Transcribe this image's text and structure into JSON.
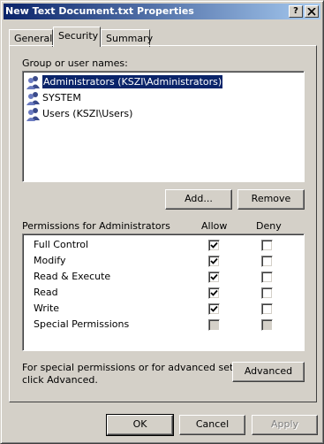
{
  "window": {
    "title": "New Text Document.txt Properties"
  },
  "titlebar": {
    "help_label": "?",
    "close_label": "X"
  },
  "tabs": [
    {
      "label": "General",
      "active": false
    },
    {
      "label": "Security",
      "active": true
    },
    {
      "label": "Summary",
      "active": false
    }
  ],
  "security": {
    "group_label": "Group or user names:",
    "users": [
      {
        "name": "Administrators (KSZI\\Administrators)",
        "selected": true,
        "icon": "user-group-icon"
      },
      {
        "name": "SYSTEM",
        "selected": false,
        "icon": "user-group-icon"
      },
      {
        "name": "Users (KSZI\\Users)",
        "selected": false,
        "icon": "user-group-icon"
      }
    ],
    "add_label": "Add...",
    "remove_label": "Remove",
    "permissions_label": "Permissions for Administrators",
    "allow_header": "Allow",
    "deny_header": "Deny",
    "permissions": [
      {
        "name": "Full Control",
        "allow": true,
        "deny": false,
        "allow_disabled": false,
        "deny_disabled": false
      },
      {
        "name": "Modify",
        "allow": true,
        "deny": false,
        "allow_disabled": false,
        "deny_disabled": false
      },
      {
        "name": "Read & Execute",
        "allow": true,
        "deny": false,
        "allow_disabled": false,
        "deny_disabled": false
      },
      {
        "name": "Read",
        "allow": true,
        "deny": false,
        "allow_disabled": false,
        "deny_disabled": false
      },
      {
        "name": "Write",
        "allow": true,
        "deny": false,
        "allow_disabled": false,
        "deny_disabled": false
      },
      {
        "name": "Special Permissions",
        "allow": false,
        "deny": false,
        "allow_disabled": true,
        "deny_disabled": true
      }
    ],
    "advanced_hint_line1": "For special permissions or for advanced settings,",
    "advanced_hint_line2": "click Advanced.",
    "advanced_label": "Advanced"
  },
  "footer": {
    "ok_label": "OK",
    "cancel_label": "Cancel",
    "apply_label": "Apply"
  }
}
